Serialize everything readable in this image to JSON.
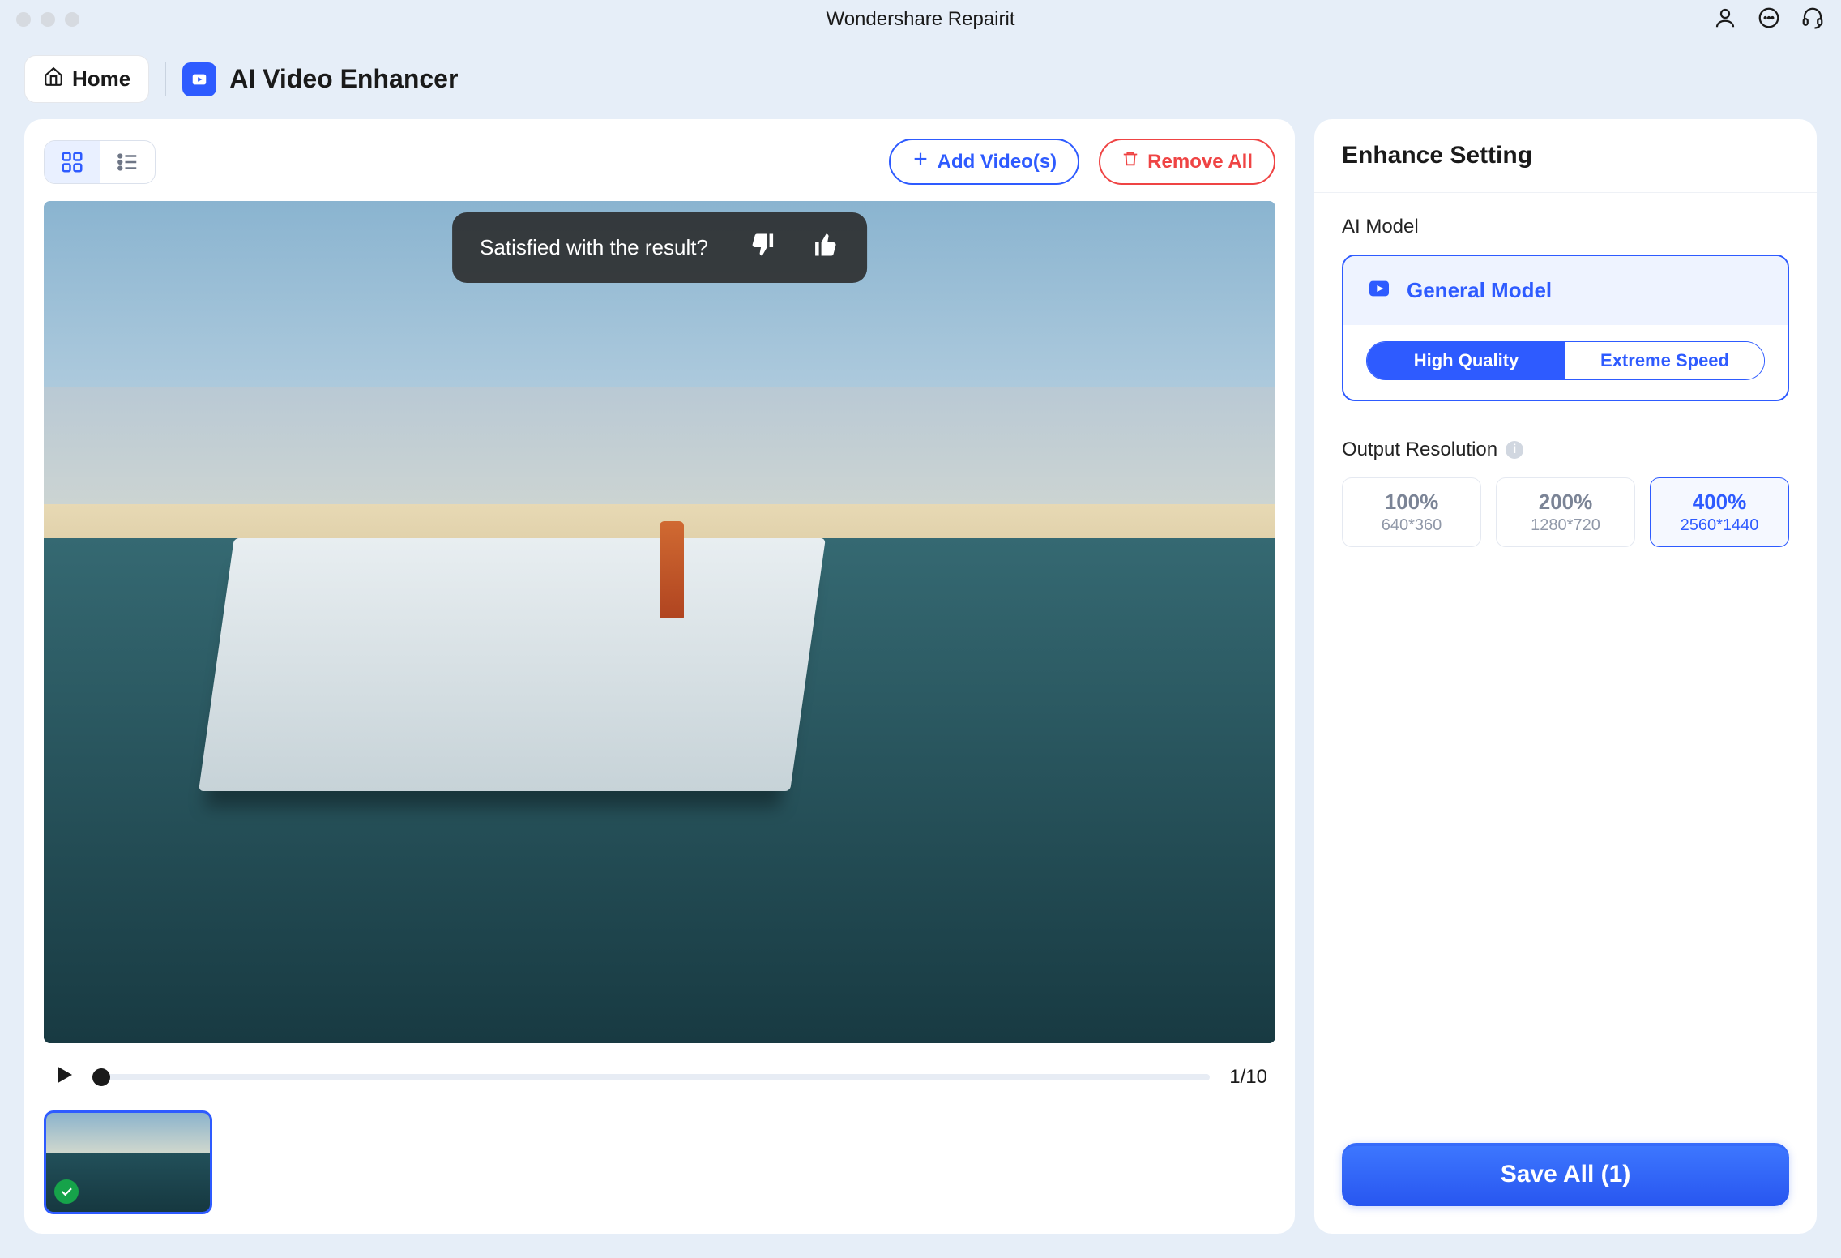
{
  "app": {
    "title": "Wondershare Repairit"
  },
  "breadcrumb": {
    "home": "Home",
    "page": "AI Video Enhancer"
  },
  "toolbar": {
    "add": "Add Video(s)",
    "remove": "Remove All"
  },
  "feedback": {
    "prompt": "Satisfied with the result?"
  },
  "player": {
    "frame": "1/10"
  },
  "settings": {
    "title": "Enhance Setting",
    "ai_model_label": "AI Model",
    "model_name": "General Model",
    "quality": {
      "high": "High Quality",
      "speed": "Extreme Speed"
    },
    "resolution_label": "Output Resolution",
    "resolutions": [
      {
        "pct": "100%",
        "dim": "640*360"
      },
      {
        "pct": "200%",
        "dim": "1280*720"
      },
      {
        "pct": "400%",
        "dim": "2560*1440"
      }
    ],
    "save": "Save All (1)"
  }
}
